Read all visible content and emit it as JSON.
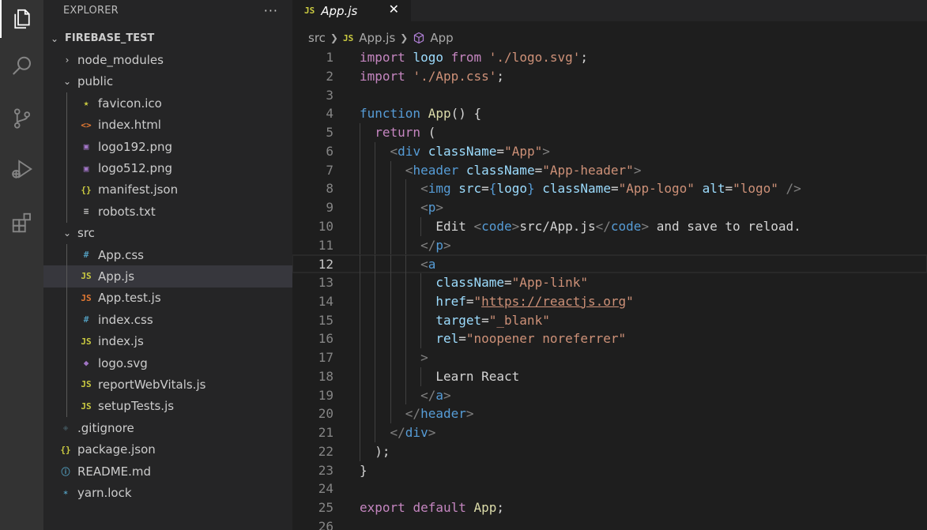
{
  "activity_bar": {
    "items": [
      {
        "name": "explorer",
        "icon": "files-icon",
        "active": true
      },
      {
        "name": "search",
        "icon": "search-icon"
      },
      {
        "name": "source-control",
        "icon": "source-control-icon"
      },
      {
        "name": "run-debug",
        "icon": "run-debug-icon"
      },
      {
        "name": "extensions",
        "icon": "extensions-icon"
      }
    ]
  },
  "sidebar": {
    "title": "EXPLORER",
    "more": "···",
    "root": "FIREBASE_TEST",
    "tree": [
      {
        "label": "node_modules",
        "type": "folder",
        "expanded": false,
        "depth": 1
      },
      {
        "label": "public",
        "type": "folder",
        "expanded": true,
        "depth": 1
      },
      {
        "label": "favicon.ico",
        "type": "file",
        "icon": "star-icon",
        "color": "#cbcb41",
        "depth": 2
      },
      {
        "label": "index.html",
        "type": "file",
        "icon": "html-icon",
        "color": "#e37933",
        "depth": 2
      },
      {
        "label": "logo192.png",
        "type": "file",
        "icon": "image-icon",
        "color": "#a074c4",
        "depth": 2
      },
      {
        "label": "logo512.png",
        "type": "file",
        "icon": "image-icon",
        "color": "#a074c4",
        "depth": 2
      },
      {
        "label": "manifest.json",
        "type": "file",
        "icon": "json-icon",
        "color": "#cbcb41",
        "depth": 2
      },
      {
        "label": "robots.txt",
        "type": "file",
        "icon": "text-icon",
        "color": "#c5c5c5",
        "depth": 2
      },
      {
        "label": "src",
        "type": "folder",
        "expanded": true,
        "depth": 1
      },
      {
        "label": "App.css",
        "type": "file",
        "icon": "css-icon",
        "color": "#519aba",
        "depth": 2
      },
      {
        "label": "App.js",
        "type": "file",
        "icon": "js-icon",
        "color": "#cbcb41",
        "depth": 2,
        "selected": true
      },
      {
        "label": "App.test.js",
        "type": "file",
        "icon": "test-js-icon",
        "color": "#e37933",
        "depth": 2
      },
      {
        "label": "index.css",
        "type": "file",
        "icon": "css-icon",
        "color": "#519aba",
        "depth": 2
      },
      {
        "label": "index.js",
        "type": "file",
        "icon": "js-icon",
        "color": "#cbcb41",
        "depth": 2
      },
      {
        "label": "logo.svg",
        "type": "file",
        "icon": "svg-icon",
        "color": "#a074c4",
        "depth": 2
      },
      {
        "label": "reportWebVitals.js",
        "type": "file",
        "icon": "js-icon",
        "color": "#cbcb41",
        "depth": 2
      },
      {
        "label": "setupTests.js",
        "type": "file",
        "icon": "js-icon",
        "color": "#cbcb41",
        "depth": 2
      },
      {
        "label": ".gitignore",
        "type": "file",
        "icon": "git-icon",
        "color": "#41535b",
        "depth": 1
      },
      {
        "label": "package.json",
        "type": "file",
        "icon": "json-icon",
        "color": "#cbcb41",
        "depth": 1
      },
      {
        "label": "README.md",
        "type": "file",
        "icon": "info-icon",
        "color": "#519aba",
        "depth": 1
      },
      {
        "label": "yarn.lock",
        "type": "file",
        "icon": "yarn-icon",
        "color": "#519aba",
        "depth": 1
      }
    ]
  },
  "editor": {
    "tab": {
      "badge": "JS",
      "title": "App.js",
      "close": "✕"
    },
    "breadcrumb": {
      "folder": "src",
      "file_badge": "JS",
      "file": "App.js",
      "symbol": "App"
    },
    "current_line": 12,
    "lines": [
      {
        "n": "1",
        "indent": 0,
        "tokens": [
          [
            "kw",
            "import"
          ],
          [
            "tx",
            " "
          ],
          [
            "vr",
            "logo"
          ],
          [
            "tx",
            " "
          ],
          [
            "kw",
            "from"
          ],
          [
            "tx",
            " "
          ],
          [
            "st",
            "'./logo.svg'"
          ],
          [
            "tx",
            ";"
          ]
        ]
      },
      {
        "n": "2",
        "indent": 0,
        "tokens": [
          [
            "kw",
            "import"
          ],
          [
            "tx",
            " "
          ],
          [
            "st",
            "'./App.css'"
          ],
          [
            "tx",
            ";"
          ]
        ]
      },
      {
        "n": "3",
        "indent": 0,
        "tokens": []
      },
      {
        "n": "4",
        "indent": 0,
        "tokens": [
          [
            "sb",
            "function"
          ],
          [
            "tx",
            " "
          ],
          [
            "fn",
            "App"
          ],
          [
            "tx",
            "() {"
          ]
        ]
      },
      {
        "n": "5",
        "indent": 1,
        "tokens": [
          [
            "tx",
            "  "
          ],
          [
            "kw",
            "return"
          ],
          [
            "tx",
            " ("
          ]
        ]
      },
      {
        "n": "6",
        "indent": 2,
        "tokens": [
          [
            "tx",
            "    "
          ],
          [
            "pu",
            "<"
          ],
          [
            "tg",
            "div"
          ],
          [
            "tx",
            " "
          ],
          [
            "at",
            "className"
          ],
          [
            "tx",
            "="
          ],
          [
            "st",
            "\"App\""
          ],
          [
            "pu",
            ">"
          ]
        ]
      },
      {
        "n": "7",
        "indent": 3,
        "tokens": [
          [
            "tx",
            "      "
          ],
          [
            "pu",
            "<"
          ],
          [
            "tg",
            "header"
          ],
          [
            "tx",
            " "
          ],
          [
            "at",
            "className"
          ],
          [
            "tx",
            "="
          ],
          [
            "st",
            "\"App-header\""
          ],
          [
            "pu",
            ">"
          ]
        ]
      },
      {
        "n": "8",
        "indent": 4,
        "tokens": [
          [
            "tx",
            "        "
          ],
          [
            "pu",
            "<"
          ],
          [
            "tg",
            "img"
          ],
          [
            "tx",
            " "
          ],
          [
            "at",
            "src"
          ],
          [
            "tx",
            "="
          ],
          [
            "br",
            "{"
          ],
          [
            "vr",
            "logo"
          ],
          [
            "br",
            "}"
          ],
          [
            "tx",
            " "
          ],
          [
            "at",
            "className"
          ],
          [
            "tx",
            "="
          ],
          [
            "st",
            "\"App-logo\""
          ],
          [
            "tx",
            " "
          ],
          [
            "at",
            "alt"
          ],
          [
            "tx",
            "="
          ],
          [
            "st",
            "\"logo\""
          ],
          [
            "tx",
            " "
          ],
          [
            "pu",
            "/>"
          ]
        ]
      },
      {
        "n": "9",
        "indent": 4,
        "tokens": [
          [
            "tx",
            "        "
          ],
          [
            "pu",
            "<"
          ],
          [
            "tg",
            "p"
          ],
          [
            "pu",
            ">"
          ]
        ]
      },
      {
        "n": "10",
        "indent": 5,
        "tokens": [
          [
            "tx",
            "          Edit "
          ],
          [
            "pu",
            "<"
          ],
          [
            "tg",
            "code"
          ],
          [
            "pu",
            ">"
          ],
          [
            "tx",
            "src/App.js"
          ],
          [
            "pu",
            "</"
          ],
          [
            "tg",
            "code"
          ],
          [
            "pu",
            ">"
          ],
          [
            "tx",
            " and save to reload."
          ]
        ]
      },
      {
        "n": "11",
        "indent": 4,
        "tokens": [
          [
            "tx",
            "        "
          ],
          [
            "pu",
            "</"
          ],
          [
            "tg",
            "p"
          ],
          [
            "pu",
            ">"
          ]
        ]
      },
      {
        "n": "12",
        "indent": 4,
        "tokens": [
          [
            "tx",
            "        "
          ],
          [
            "pu",
            "<"
          ],
          [
            "tg",
            "a"
          ]
        ]
      },
      {
        "n": "13",
        "indent": 5,
        "tokens": [
          [
            "tx",
            "          "
          ],
          [
            "at",
            "className"
          ],
          [
            "tx",
            "="
          ],
          [
            "st",
            "\"App-link\""
          ]
        ]
      },
      {
        "n": "14",
        "indent": 5,
        "tokens": [
          [
            "tx",
            "          "
          ],
          [
            "at",
            "href"
          ],
          [
            "tx",
            "="
          ],
          [
            "st",
            "\""
          ],
          [
            "stu",
            "https://reactjs.org"
          ],
          [
            "st",
            "\""
          ]
        ]
      },
      {
        "n": "15",
        "indent": 5,
        "tokens": [
          [
            "tx",
            "          "
          ],
          [
            "at",
            "target"
          ],
          [
            "tx",
            "="
          ],
          [
            "st",
            "\"_blank\""
          ]
        ]
      },
      {
        "n": "16",
        "indent": 5,
        "tokens": [
          [
            "tx",
            "          "
          ],
          [
            "at",
            "rel"
          ],
          [
            "tx",
            "="
          ],
          [
            "st",
            "\"noopener noreferrer\""
          ]
        ]
      },
      {
        "n": "17",
        "indent": 4,
        "tokens": [
          [
            "tx",
            "        "
          ],
          [
            "pu",
            ">"
          ]
        ]
      },
      {
        "n": "18",
        "indent": 5,
        "tokens": [
          [
            "tx",
            "          Learn React"
          ]
        ]
      },
      {
        "n": "19",
        "indent": 4,
        "tokens": [
          [
            "tx",
            "        "
          ],
          [
            "pu",
            "</"
          ],
          [
            "tg",
            "a"
          ],
          [
            "pu",
            ">"
          ]
        ]
      },
      {
        "n": "20",
        "indent": 3,
        "tokens": [
          [
            "tx",
            "      "
          ],
          [
            "pu",
            "</"
          ],
          [
            "tg",
            "header"
          ],
          [
            "pu",
            ">"
          ]
        ]
      },
      {
        "n": "21",
        "indent": 2,
        "tokens": [
          [
            "tx",
            "    "
          ],
          [
            "pu",
            "</"
          ],
          [
            "tg",
            "div"
          ],
          [
            "pu",
            ">"
          ]
        ]
      },
      {
        "n": "22",
        "indent": 1,
        "tokens": [
          [
            "tx",
            "  );"
          ]
        ]
      },
      {
        "n": "23",
        "indent": 0,
        "tokens": [
          [
            "tx",
            "}"
          ]
        ]
      },
      {
        "n": "24",
        "indent": 0,
        "tokens": []
      },
      {
        "n": "25",
        "indent": 0,
        "tokens": [
          [
            "kw",
            "export"
          ],
          [
            "tx",
            " "
          ],
          [
            "kw",
            "default"
          ],
          [
            "tx",
            " "
          ],
          [
            "fn",
            "App"
          ],
          [
            "tx",
            ";"
          ]
        ]
      },
      {
        "n": "26",
        "indent": 0,
        "tokens": []
      }
    ]
  }
}
